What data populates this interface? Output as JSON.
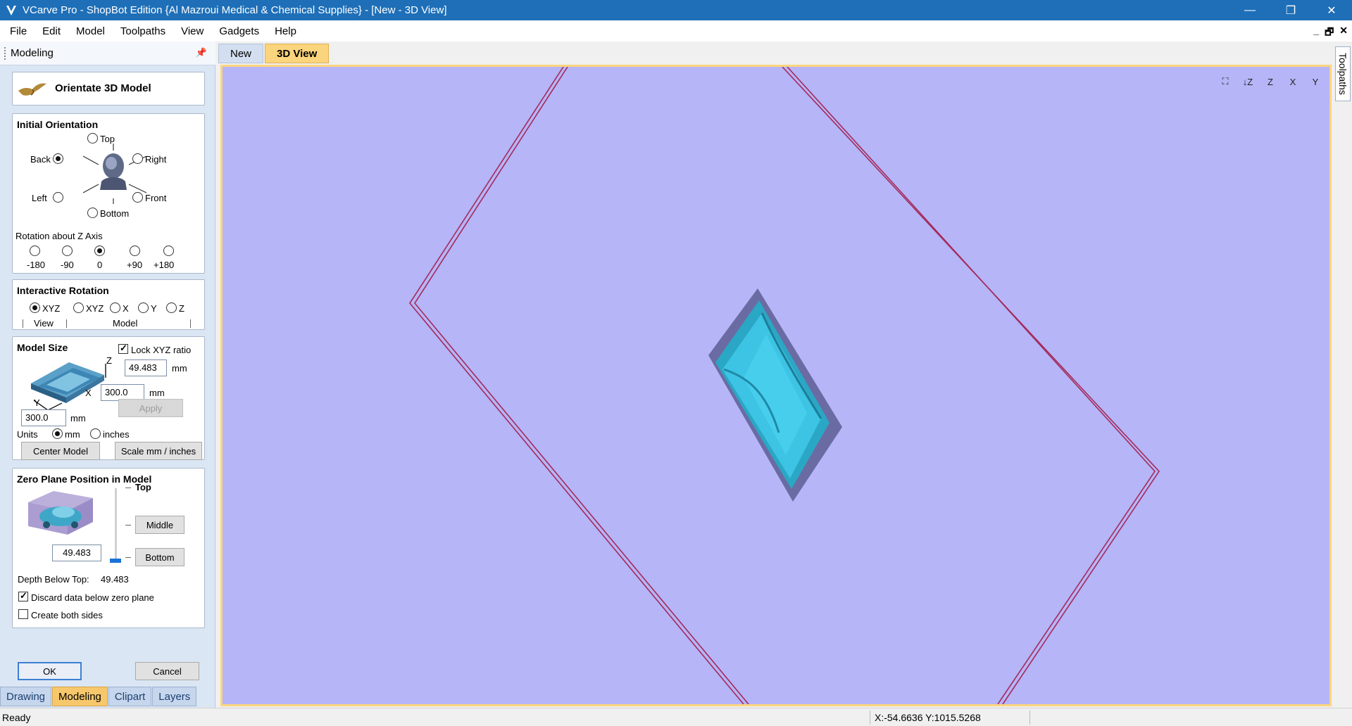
{
  "window": {
    "title": "VCarve Pro - ShopBot Edition {Al Mazroui Medical & Chemical Supplies} - [New - 3D View]",
    "minimize": "—",
    "restore": "❐",
    "close": "✕"
  },
  "menu": {
    "items": [
      "File",
      "Edit",
      "Model",
      "Toolpaths",
      "View",
      "Gadgets",
      "Help"
    ],
    "mdi_min": "_",
    "mdi_restore": "🗗",
    "mdi_close": "✕"
  },
  "panel": {
    "title": "Modeling",
    "pin": "📌",
    "header_title": "Orientate 3D Model",
    "initial_orientation": {
      "title": "Initial Orientation",
      "top": "Top",
      "back": "Back",
      "right": "Right",
      "left": "Left",
      "front": "Front",
      "bottom": "Bottom",
      "selected": "Back",
      "rotation_title": "Rotation about Z Axis",
      "rotations": [
        "-180",
        "-90",
        "0",
        "+90",
        "+180"
      ],
      "rotation_selected": "0"
    },
    "interactive_rotation": {
      "title": "Interactive Rotation",
      "options": [
        "XYZ",
        "XYZ",
        "X",
        "Y",
        "Z"
      ],
      "selected_index": 0,
      "view_label": "View",
      "model_label": "Model"
    },
    "model_size": {
      "title": "Model Size",
      "lock_label": "Lock XYZ ratio",
      "lock_checked": true,
      "z_label": "Z",
      "x_label": "X",
      "y_label": "Y",
      "z_value": "49.483",
      "x_value": "300.0",
      "y_value": "300.0",
      "unit": "mm",
      "apply": "Apply",
      "units_label": "Units",
      "unit_mm": "mm",
      "unit_inches": "inches",
      "units_selected": "mm",
      "center_model": "Center Model",
      "scale_units": "Scale mm / inches"
    },
    "zero_plane": {
      "title": "Zero Plane Position in Model",
      "top_label": "Top",
      "middle": "Middle",
      "bottom": "Bottom",
      "value": "49.483",
      "slider_fraction": 1.0,
      "depth_label": "Depth Below Top:",
      "depth_value": "49.483",
      "discard_label": "Discard data below zero plane",
      "discard_checked": true,
      "both_sides_label": "Create both sides",
      "both_sides_checked": false
    },
    "ok": "OK",
    "cancel": "Cancel",
    "tabs": [
      "Drawing",
      "Modeling",
      "Clipart",
      "Layers"
    ],
    "active_tab": "Modeling"
  },
  "document_tabs": [
    "New",
    "3D View"
  ],
  "active_document_tab": "3D View",
  "view_tools": [
    "⛶",
    "↓Z",
    "Z",
    "X",
    "Y"
  ],
  "right_tab": "Toolpaths",
  "status": {
    "text": "Ready",
    "coords": "X:-54.6636 Y:1015.5268"
  },
  "colors": {
    "viewport_bg": "#b5b5f8",
    "viewport_border": "#fbd57d",
    "model_cyan": "#37c6e4",
    "model_edge": "#6d6d9e",
    "outline": "#a52a5a",
    "active_tab": "#f7c76b"
  }
}
